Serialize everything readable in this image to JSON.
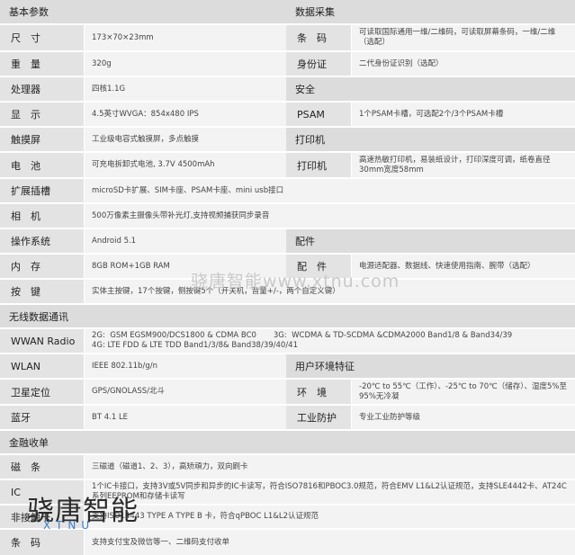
{
  "sections": {
    "basic": "基本参数",
    "data_collect": "数据采集",
    "security": "安全",
    "printer": "打印机",
    "accessories": "配件",
    "wireless": "无线数据通讯",
    "env": "用户环境特征",
    "finance": "金融收单"
  },
  "rows": {
    "size": {
      "label": "尺　寸",
      "value": "173×70×23mm"
    },
    "barcode": {
      "label": "条　码",
      "value": "可读取国际通用一维/二维码，可读取屏幕条码，一维/二维（选配）"
    },
    "weight": {
      "label": "重　量",
      "value": "320g"
    },
    "idcard": {
      "label": "身份证",
      "value": "二代身份证识别（选配）"
    },
    "cpu": {
      "label": "处理器",
      "value": "四核1.1G"
    },
    "display": {
      "label": "显　示",
      "value": "4.5英寸WVGA：854x480 IPS"
    },
    "psam": {
      "label": "PSAM",
      "value": "1个PSAM卡槽，可选配2个/3个PSAM卡槽"
    },
    "touch": {
      "label": "触摸屏",
      "value": "工业级电容式触摸屏，多点触摸"
    },
    "battery": {
      "label": "电　池",
      "value": "可充电拆卸式电池, 3.7V 4500mAh"
    },
    "printer": {
      "label": "打印机",
      "value": "高速热敏打印机，易装纸设计，打印深度可调，纸卷直径30mm宽度58mm"
    },
    "expansion": {
      "label": "扩展插槽",
      "value": "microSD卡扩展、SIM卡座、PSAM卡座、mini usb接口"
    },
    "camera": {
      "label": "相　机",
      "value": "500万像素主摄像头带补光灯,支持视频捕获同步录音"
    },
    "os": {
      "label": "操作系统",
      "value": "Android 5.1"
    },
    "memory": {
      "label": "内　存",
      "value": "8GB ROM+1GB RAM"
    },
    "accessory": {
      "label": "配　件",
      "value": "电源适配器、数据线、快速使用指南、腕带（选配）"
    },
    "keys": {
      "label": "按　键",
      "value": "实体主按键，17个按键，侧按键5个（开关机，音量+/-，两个自定义键）"
    },
    "wwan": {
      "label": "WWAN Radio",
      "value1": "2G:  GSM EGSM900/DCS1800 & CDMA BC0       3G:  WCDMA & TD-SCDMA &CDMA2000 Band1/8 & Band34/39",
      "value2": "4G:  LTE FDD & LTE TDD Band1/3/8& Band38/39/40/41"
    },
    "wlan": {
      "label": "WLAN",
      "value": "IEEE 802.11b/g/n"
    },
    "gps": {
      "label": "卫星定位",
      "value": "GPS/GNOLASS/北斗"
    },
    "environment": {
      "label": "环　境",
      "value": "-20℃ to 55℃（工作）、-25℃ to 70℃（储存）、湿度5%至95%无冷凝"
    },
    "bluetooth": {
      "label": "蓝牙",
      "value": "BT 4.1 LE"
    },
    "protection": {
      "label": "工业防护",
      "value": "专业工业防护等级"
    },
    "magstripe": {
      "label": "磁　条",
      "value": "三磁道（磁道1、2、3），高矫頑力，双向刷卡"
    },
    "ic": {
      "label": "IC",
      "value": "1个IC卡接口，支持3V或5V同步和异步的IC卡读写，符合ISO7816和PBOC3.0规范，符合EMV L1&L2认证规范，支持SLE4442卡、AT24C系列EEPROM和存储卡读写"
    },
    "contactless": {
      "label": "非接触卡",
      "value": "支持ISO14443 TYPE A TYPE B 卡，符合qPBOC L1&L2认证规范"
    },
    "qrpay": {
      "label": "条　码",
      "value": "支持支付宝及微信等一、二维码支付收单"
    }
  },
  "watermarks": {
    "center": "骁唐智能www.xtnu.com",
    "logo": "骁唐智能",
    "logo_sub": "XTNU"
  }
}
